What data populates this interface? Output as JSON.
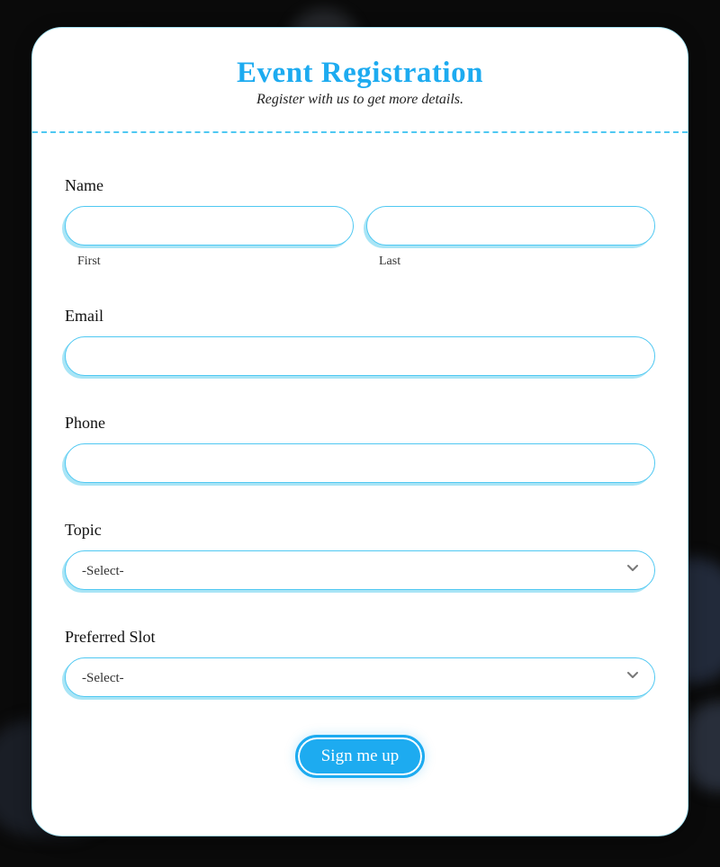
{
  "header": {
    "title": "Event Registration",
    "subtitle": "Register with us to get more details."
  },
  "form": {
    "name": {
      "label": "Name",
      "first_sublabel": "First",
      "last_sublabel": "Last",
      "first_value": "",
      "last_value": ""
    },
    "email": {
      "label": "Email",
      "value": ""
    },
    "phone": {
      "label": "Phone",
      "value": ""
    },
    "topic": {
      "label": "Topic",
      "selected": "-Select-"
    },
    "slot": {
      "label": "Preferred Slot",
      "selected": "-Select-"
    },
    "submit_label": "Sign me up"
  },
  "colors": {
    "accent": "#1dabf0",
    "border": "#4fc8f2",
    "shadow": "#a9e5f6"
  }
}
